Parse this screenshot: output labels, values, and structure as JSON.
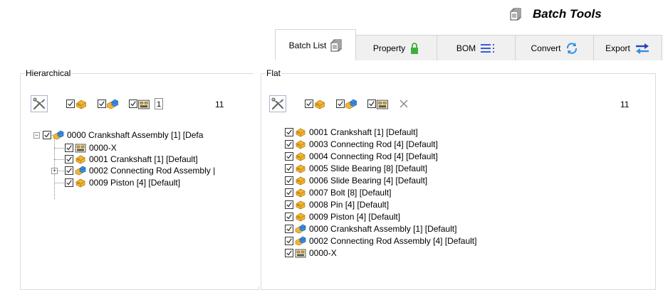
{
  "app": {
    "title": "Batch Tools",
    "title_icon": "documents-icon"
  },
  "tabs": [
    {
      "label": "Batch List",
      "icon": "documents-icon",
      "active": true
    },
    {
      "label": "Property",
      "icon": "lock-icon",
      "active": false
    },
    {
      "label": "BOM",
      "icon": "list-icon",
      "active": false
    },
    {
      "label": "Convert",
      "icon": "refresh-icon",
      "active": false
    },
    {
      "label": "Export",
      "icon": "swap-arrows-icon",
      "active": false
    }
  ],
  "hierarchical": {
    "label": "Hierarchical",
    "level_input": "1",
    "count": "11",
    "filters": [
      "part-filter",
      "assembly-filter",
      "drawing-filter"
    ],
    "tree": [
      {
        "text": "0000  Crankshaft Assembly  [1]  [Defa",
        "type": "assembly",
        "level": 0,
        "expander": "minus"
      },
      {
        "text": "0000-X",
        "type": "drawing",
        "level": 1
      },
      {
        "text": "0001  Crankshaft  [1]  [Default]",
        "type": "part",
        "level": 1
      },
      {
        "text": "0002  Connecting Rod Assembly  |",
        "type": "assembly",
        "level": 1,
        "expander": "plus"
      },
      {
        "text": "0009  Piston  [4]  [Default]",
        "type": "part",
        "level": 1
      }
    ]
  },
  "flat": {
    "label": "Flat",
    "count": "11",
    "filters": [
      "part-filter",
      "assembly-filter",
      "drawing-filter"
    ],
    "items": [
      {
        "text": "0001  Crankshaft  [1]  [Default]",
        "type": "part"
      },
      {
        "text": "0003  Connecting Rod  [4]  [Default]",
        "type": "part"
      },
      {
        "text": "0004  Connecting Rod  [4]  [Default]",
        "type": "part"
      },
      {
        "text": "0005  Slide Bearing  [8]  [Default]",
        "type": "part"
      },
      {
        "text": "0006  Slide Bearing  [4]  [Default]",
        "type": "part"
      },
      {
        "text": "0007  Bolt  [8]  [Default]",
        "type": "part"
      },
      {
        "text": "0008  Pin  [4]  [Default]",
        "type": "part"
      },
      {
        "text": "0009  Piston  [4]  [Default]",
        "type": "part"
      },
      {
        "text": "0000  Crankshaft Assembly  [1]  [Default]",
        "type": "assembly"
      },
      {
        "text": "0002  Connecting Rod Assembly  [4]  [Default]",
        "type": "assembly"
      },
      {
        "text": "0000-X",
        "type": "drawing"
      }
    ]
  },
  "colors": {
    "part_orange": "#e8a317",
    "assembly_blue": "#2d7fd3",
    "green_lock": "#3fae3f",
    "tab_border": "#d4d4d4"
  }
}
